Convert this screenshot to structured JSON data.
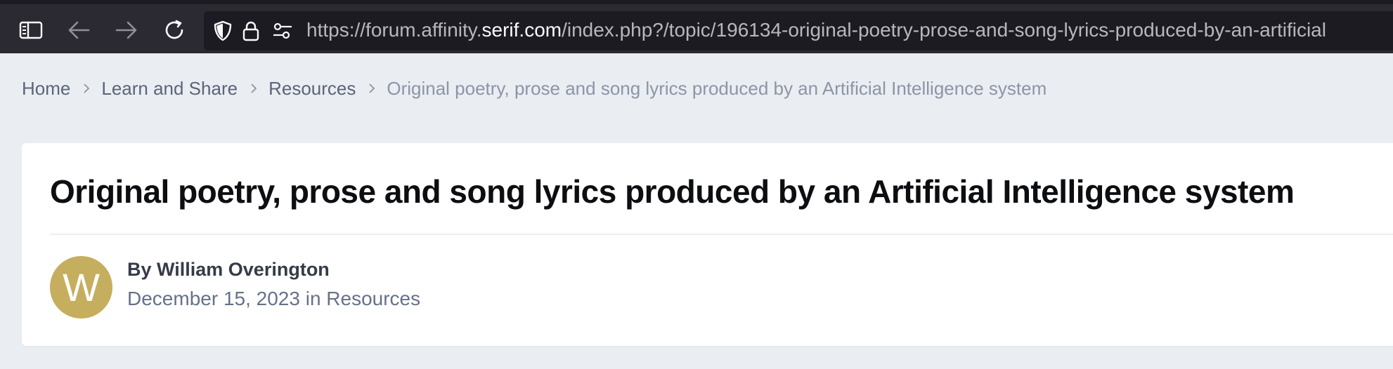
{
  "browser": {
    "url_prefix": "https://forum.affinity.",
    "url_host": "serif.com",
    "url_suffix": "/index.php?/topic/196134-original-poetry-prose-and-song-lyrics-produced-by-an-artificial",
    "icons": [
      "sidebar-icon",
      "back-arrow-icon",
      "forward-arrow-icon",
      "reload-icon",
      "shield-icon",
      "lock-icon",
      "permissions-icon"
    ]
  },
  "breadcrumb": {
    "items": [
      "Home",
      "Learn and Share",
      "Resources"
    ],
    "current": "Original poetry, prose and song lyrics produced by an Artificial Intelligence system"
  },
  "topic": {
    "title": "Original poetry, prose and song lyrics produced by an Artificial Intelligence system",
    "avatar_letter": "W",
    "avatar_color": "#c5ae5e",
    "author": "By William Overington",
    "date": "December 15, 2023",
    "in_word": "in",
    "category": "Resources"
  }
}
